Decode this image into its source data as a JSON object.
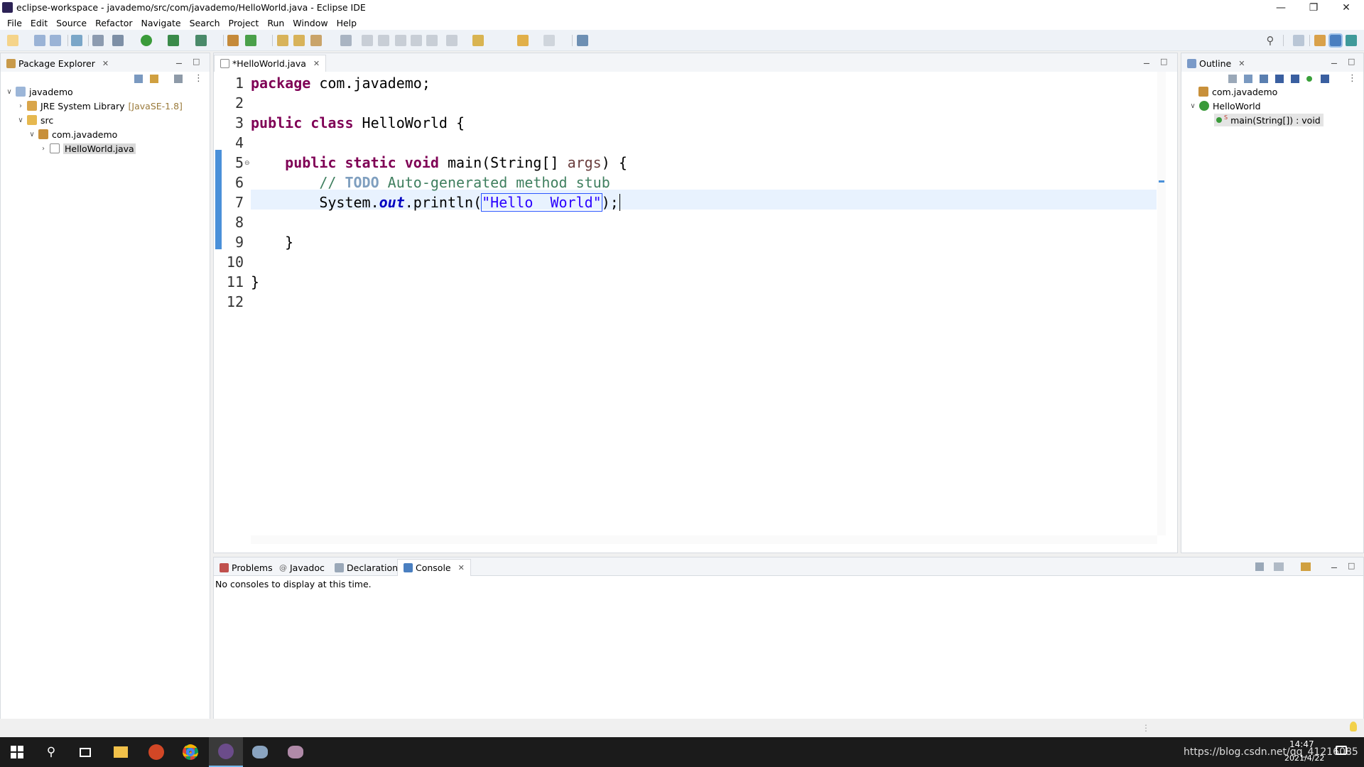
{
  "window": {
    "title": "eclipse-workspace - javademo/src/com/javademo/HelloWorld.java - Eclipse IDE"
  },
  "menu": [
    "File",
    "Edit",
    "Source",
    "Refactor",
    "Navigate",
    "Search",
    "Project",
    "Run",
    "Window",
    "Help"
  ],
  "package_explorer": {
    "title": "Package Explorer",
    "tree": [
      {
        "label": "javademo",
        "indent": 0,
        "expanded": true,
        "icon": "project-icon"
      },
      {
        "label": "JRE System Library",
        "suffix": "[JavaSE-1.8]",
        "indent": 1,
        "expanded": false,
        "icon": "library-icon"
      },
      {
        "label": "src",
        "indent": 1,
        "expanded": true,
        "icon": "source-folder-icon"
      },
      {
        "label": "com.javademo",
        "indent": 2,
        "expanded": true,
        "icon": "package-icon"
      },
      {
        "label": "HelloWorld.java",
        "indent": 3,
        "expanded": false,
        "icon": "java-file-icon",
        "selected": true
      }
    ]
  },
  "editor": {
    "tab_label": "*HelloWorld.java",
    "current_line": 7,
    "lines": [
      "1",
      "2",
      "3",
      "4",
      "5",
      "6",
      "7",
      "8",
      "9",
      "10",
      "11",
      "12"
    ],
    "code": {
      "l1_kw": "package",
      "l1_rest": " com.javademo;",
      "l3_kw1": "public",
      "l3_kw2": "class",
      "l3_rest": " HelloWorld {",
      "l5_kw1": "public",
      "l5_kw2": "static",
      "l5_kw3": "void",
      "l5_rest1": " main(String[] ",
      "l5_param": "args",
      "l5_rest2": ") {",
      "l6_c1": "// ",
      "l6_todo": "TODO",
      "l6_c2": " Auto-generated method stub",
      "l7_a": "System.",
      "l7_out": "out",
      "l7_b": ".println(",
      "l7_str": "\"Hello  World\"",
      "l7_c": ");",
      "l9": "}",
      "l11": "}"
    }
  },
  "outline": {
    "title": "Outline",
    "items": [
      {
        "label": "com.javademo",
        "icon": "package-icon"
      },
      {
        "label": "HelloWorld",
        "icon": "class-icon"
      },
      {
        "label": "main(String[]) : void",
        "icon": "method-icon"
      }
    ]
  },
  "bottom_panel": {
    "tabs": [
      {
        "label": "Problems",
        "icon": "problems-icon"
      },
      {
        "label": "Javadoc",
        "icon": "javadoc-icon"
      },
      {
        "label": "Declaration",
        "icon": "declaration-icon"
      },
      {
        "label": "Console",
        "icon": "console-icon",
        "active": true
      }
    ],
    "console_message": "No consoles to display at this time."
  },
  "taskbar": {
    "time": "14:47",
    "date": "2021/4/22",
    "watermark": "https://blog.csdn.net/qq_41216085"
  },
  "colors": {
    "accent": "#4a90d9",
    "keyword": "#7f0055",
    "string": "#2a00ff",
    "comment": "#3f7f5f"
  }
}
